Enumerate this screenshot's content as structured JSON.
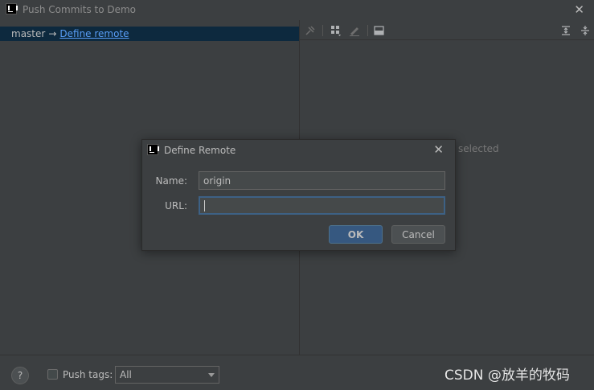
{
  "window": {
    "title": "Push Commits to Demo",
    "close_glyph": "✕"
  },
  "left_panel": {
    "branch": "master",
    "arrow": "→",
    "define_remote_link": "Define remote"
  },
  "right_panel": {
    "empty_hint": "selected"
  },
  "toolbar": {
    "icons": [
      "pin-icon",
      "group-icon",
      "edit-icon",
      "preview-icon",
      "expand-all-icon",
      "collapse-all-icon"
    ]
  },
  "bottom": {
    "help": "?",
    "push_tags_label": "Push tags:",
    "push_tags_value": "All",
    "watermark": "CSDN @放羊的牧码"
  },
  "dialog": {
    "title": "Define Remote",
    "close_glyph": "✕",
    "name_label": "Name:",
    "name_value": "origin",
    "url_label": "URL:",
    "url_value": "",
    "ok_label": "OK",
    "cancel_label": "Cancel"
  },
  "colors": {
    "background": "#3c3f41",
    "selection": "#0d293e",
    "link": "#589df6",
    "ok_button": "#365880",
    "focus_border": "#3d6185"
  }
}
